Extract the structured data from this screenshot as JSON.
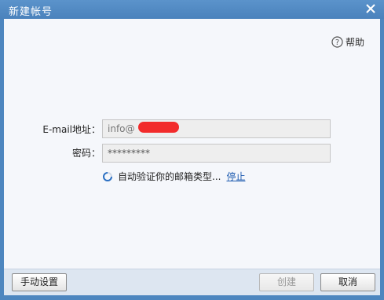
{
  "window": {
    "title": "新建帐号"
  },
  "help": {
    "label": "帮助"
  },
  "form": {
    "email_label": "E-mail地址：",
    "email_value": "info@",
    "password_label": "密码：",
    "password_value": "*********"
  },
  "status": {
    "verifying_text": "自动验证你的邮箱类型...",
    "stop_link": "停止"
  },
  "footer": {
    "manual_settings": "手动设置",
    "create": "创建",
    "cancel": "取消"
  },
  "colors": {
    "titlebar": "#4a82bc",
    "link": "#1f5cb0",
    "redaction": "#f22b2b"
  },
  "icons": [
    "close-icon",
    "help-icon",
    "loading-spinner-icon"
  ]
}
